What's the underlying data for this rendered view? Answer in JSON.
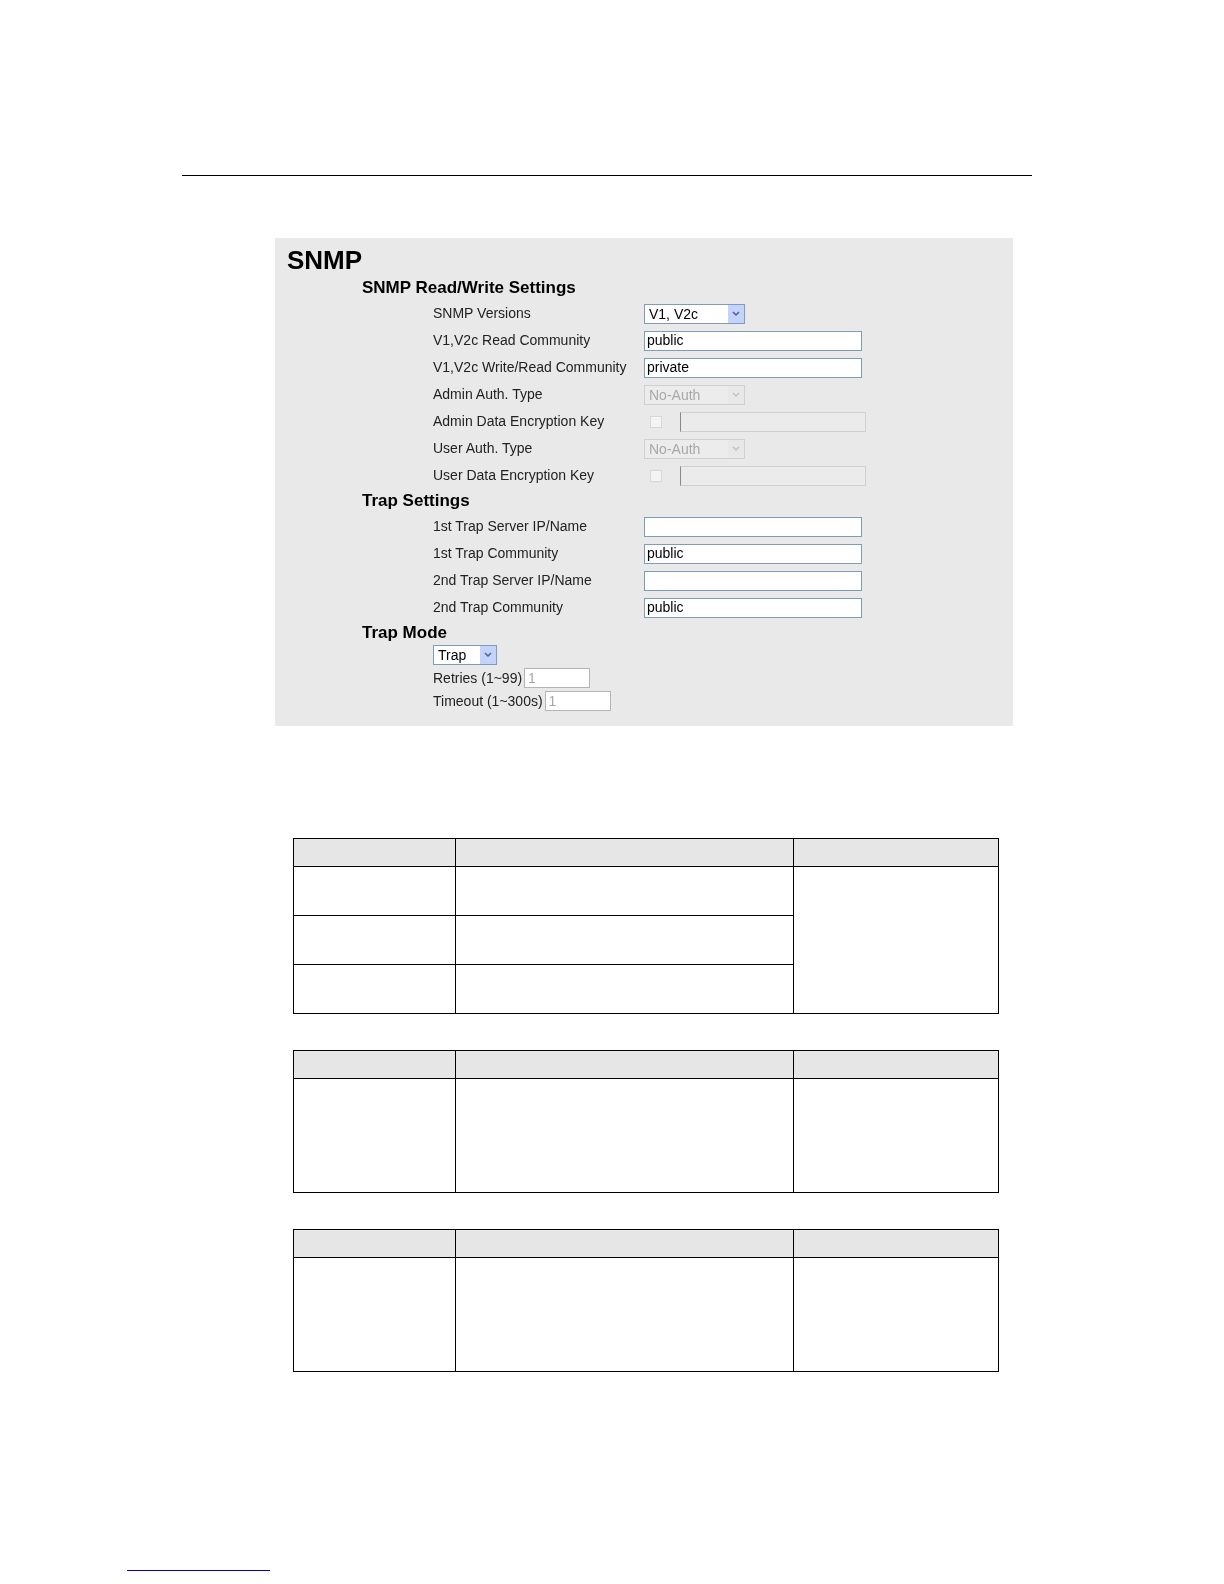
{
  "panel": {
    "title": "SNMP",
    "sections": [
      {
        "heading": "SNMP Read/Write Settings",
        "rows": [
          {
            "kind": "select",
            "label": "SNMP Versions",
            "value": "V1, V2c",
            "disabled": false
          },
          {
            "kind": "text",
            "label": "V1,V2c Read Community",
            "value": "public",
            "disabled": false
          },
          {
            "kind": "text",
            "label": "V1,V2c Write/Read Community",
            "value": "private",
            "disabled": false
          },
          {
            "kind": "select",
            "label": "Admin Auth. Type",
            "value": "No-Auth",
            "disabled": true
          },
          {
            "kind": "key",
            "label": "Admin Data Encryption Key",
            "checked": false,
            "disabled": true
          },
          {
            "kind": "select",
            "label": "User Auth. Type",
            "value": "No-Auth",
            "disabled": true
          },
          {
            "kind": "key",
            "label": "User Data Encryption Key",
            "checked": false,
            "disabled": true
          }
        ]
      },
      {
        "heading": "Trap Settings",
        "rows": [
          {
            "kind": "text",
            "label": "1st Trap Server IP/Name",
            "disabled": false
          },
          {
            "kind": "text",
            "label": "1st Trap Community",
            "value": "public",
            "disabled": false
          },
          {
            "kind": "text",
            "label": "2nd Trap Server IP/Name",
            "disabled": false
          },
          {
            "kind": "text",
            "label": "2nd Trap Community",
            "value": "public",
            "disabled": false
          }
        ]
      }
    ],
    "trap_mode": {
      "heading": "Trap Mode",
      "select": {
        "value": "Trap"
      },
      "fields": [
        {
          "label": "Retries (1~99)",
          "value": "1",
          "disabled": true
        },
        {
          "label": "Timeout (1~300s)",
          "value": "1",
          "disabled": true
        }
      ]
    }
  }
}
